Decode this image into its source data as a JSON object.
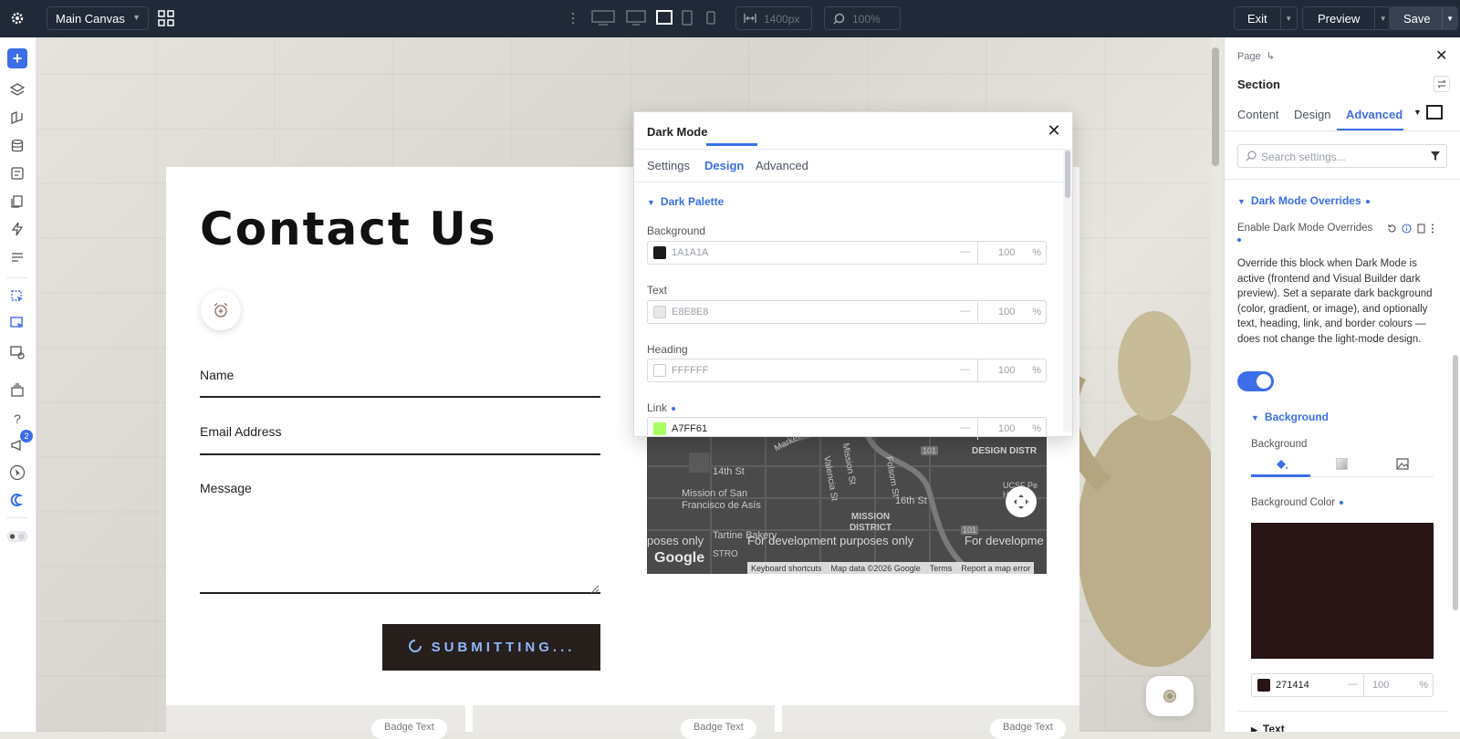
{
  "toolbar": {
    "canvas_select": "Main Canvas",
    "width_readout": "1400px",
    "zoom_readout": "100%",
    "exit_label": "Exit",
    "preview_label": "Preview",
    "save_label": "Save"
  },
  "leftbar": {
    "notification_badge": "2",
    "help_glyph": "?"
  },
  "page": {
    "title": "Contact Us",
    "name_label": "Name",
    "email_label": "Email Address",
    "message_label": "Message",
    "submit_label": "SUBMITTING...",
    "badges": [
      "Badge Text",
      "Badge Text",
      "Badge Text"
    ]
  },
  "map": {
    "streets": [
      "14th St",
      "Valencia St",
      "Mission St",
      "Folsom St",
      "16th St",
      "Market St",
      "101",
      "101"
    ],
    "places": [
      "Mission of San Francisco de Asís",
      "MISSION DISTRICT",
      "DESIGN DISTR",
      "Tartine Bakery",
      "UCSF Pe Ho Ne",
      "STRO"
    ],
    "watermark": [
      "poses only",
      "For development purposes only",
      "For developme"
    ],
    "google_logo": "Google",
    "footer": [
      "Keyboard shortcuts",
      "Map data ©2026 Google",
      "Terms",
      "Report a map error"
    ]
  },
  "modal": {
    "title": "Dark Mode",
    "tabs": [
      "Settings",
      "Design",
      "Advanced"
    ],
    "active_tab": "Design",
    "section": "Dark Palette",
    "rows": [
      {
        "label": "Background",
        "hex": "1A1A1A",
        "opacity": "100",
        "unit": "%",
        "swatch": "#1a1a1a"
      },
      {
        "label": "Text",
        "hex": "E8E8E8",
        "opacity": "100",
        "unit": "%",
        "swatch": "#e8e8e8"
      },
      {
        "label": "Heading",
        "hex": "FFFFFF",
        "opacity": "100",
        "unit": "%",
        "swatch": "#ffffff"
      },
      {
        "label": "Link",
        "hex": "A7FF61",
        "opacity": "100",
        "unit": "%",
        "swatch": "#a7ff61"
      }
    ],
    "dash": "—"
  },
  "rpanel": {
    "breadcrumb": "Page",
    "element": "Section",
    "tabs": [
      "Content",
      "Design",
      "Advanced"
    ],
    "active_tab": "Advanced",
    "search_placeholder": "Search settings...",
    "group_title": "Dark Mode Overrides",
    "enable_label": "Enable Dark Mode Overrides",
    "description": "Override this block when Dark Mode is active (frontend and Visual Builder dark preview). Set a separate dark background (color, gradient, or image), and optionally text, heading, link, and border colours — does not change the light-mode design.",
    "toggle_on": true,
    "background_group": "Background",
    "background_label": "Background",
    "bg_color_label": "Background Color",
    "bg_color_hex": "271414",
    "bg_opacity": "100",
    "bg_unit": "%",
    "text_group": "Text"
  },
  "colors": {
    "accent": "#3b6ee8",
    "topbar": "#1f2937",
    "submit_bg": "#271f1c",
    "bg_preview": "#271414"
  }
}
